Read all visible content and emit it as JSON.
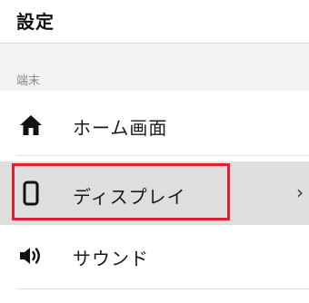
{
  "header": {
    "title": "設定"
  },
  "section": {
    "label": "端末"
  },
  "items": [
    {
      "label": "ホーム画面",
      "icon": "home-icon"
    },
    {
      "label": "ディスプレイ",
      "icon": "phone-outline-icon",
      "chevron": "›",
      "selected": true
    },
    {
      "label": "サウンド",
      "icon": "speaker-icon"
    }
  ],
  "colors": {
    "selected_row_bg": "#dedede",
    "highlight_border": "#e0202e",
    "section_bg": "#f2f2f2"
  }
}
